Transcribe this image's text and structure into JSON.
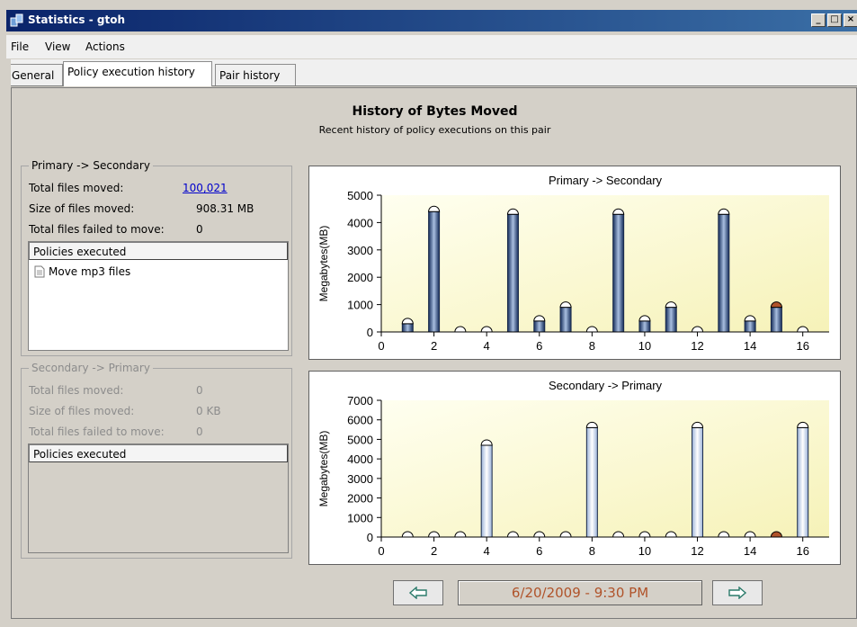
{
  "window": {
    "title": "Statistics - gtoh"
  },
  "menu": [
    "File",
    "View",
    "Actions"
  ],
  "tabs": [
    "General",
    "Policy execution history",
    "Pair history"
  ],
  "header": {
    "title": "History of Bytes Moved",
    "subtitle": "Recent history of policy executions on this pair"
  },
  "primary": {
    "legend": "Primary -> Secondary",
    "total_files_label": "Total files moved:",
    "total_files_value": "100,021",
    "size_label": "Size of files moved:",
    "size_value": "908.31 MB",
    "failed_label": "Total files failed to move:",
    "failed_value": "0",
    "policies_header": "Policies executed",
    "policies": [
      "Move mp3 files"
    ]
  },
  "secondary": {
    "legend": "Secondary -> Primary",
    "total_files_label": "Total files moved:",
    "total_files_value": "0",
    "size_label": "Size of files moved:",
    "size_value": "0 KB",
    "failed_label": "Total files failed to move:",
    "failed_value": "0",
    "policies_header": "Policies executed"
  },
  "nav": {
    "prev_icon": "left-arrow-icon",
    "next_icon": "right-arrow-icon",
    "date": "6/20/2009 - 9:30 PM"
  },
  "colors": {
    "bar_dark": "#1f3f7a",
    "bar_light": "#ffffff",
    "bar_selected": "#b0532a",
    "plot_bg_light": "#fffff0",
    "plot_bg_yellow": "#f6f2b8"
  },
  "chart_data": [
    {
      "type": "bar",
      "title": "Primary -> Secondary",
      "ylabel": "Megabytes(MB)",
      "xlim": [
        0,
        17
      ],
      "ylim": [
        0,
        5000
      ],
      "xticks": [
        0,
        2,
        4,
        6,
        8,
        10,
        12,
        14,
        16
      ],
      "yticks": [
        0,
        1000,
        2000,
        3000,
        4000,
        5000
      ],
      "x": [
        1,
        2,
        3,
        4,
        5,
        6,
        7,
        8,
        9,
        10,
        11,
        12,
        13,
        14,
        15,
        16
      ],
      "values": [
        300,
        4400,
        0,
        0,
        4300,
        400,
        900,
        0,
        4300,
        400,
        900,
        0,
        4300,
        400,
        900,
        0
      ],
      "selected_index": 14,
      "gradient": "dark"
    },
    {
      "type": "bar",
      "title": "Secondary -> Primary",
      "ylabel": "Megabytes(MB)",
      "xlim": [
        0,
        17
      ],
      "ylim": [
        0,
        7000
      ],
      "xticks": [
        0,
        2,
        4,
        6,
        8,
        10,
        12,
        14,
        16
      ],
      "yticks": [
        0,
        1000,
        2000,
        3000,
        4000,
        5000,
        6000,
        7000
      ],
      "x": [
        1,
        2,
        3,
        4,
        5,
        6,
        7,
        8,
        9,
        10,
        11,
        12,
        13,
        14,
        15,
        16
      ],
      "values": [
        0,
        0,
        0,
        4700,
        0,
        0,
        0,
        5600,
        0,
        0,
        0,
        5600,
        0,
        0,
        0,
        5600
      ],
      "selected_index": 14,
      "gradient": "light"
    }
  ]
}
